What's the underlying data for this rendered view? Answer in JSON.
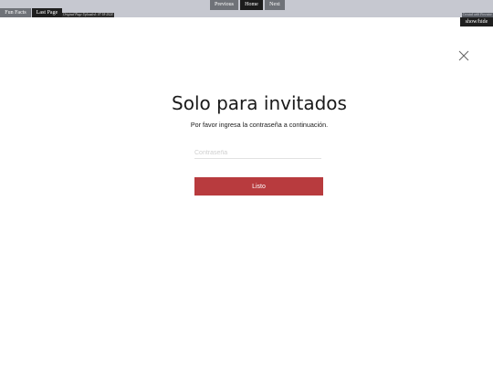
{
  "topbar": {
    "tabs": [
      {
        "label": "Fun Facts"
      },
      {
        "label": "Last Page"
      }
    ],
    "uploaded": "Original Page Uploaded: 07-18-2024",
    "nav": {
      "previous": "Previous",
      "home": "Home",
      "next": "Next"
    },
    "archived": "Created with Freewire",
    "showhide": "show/hide"
  },
  "dialog": {
    "title": "Solo para invitados",
    "subtitle": "Por favor ingresa la contraseña a continuación.",
    "password_placeholder": "Contraseña",
    "submit_label": "Listo"
  },
  "colors": {
    "topbar_bg": "#c6c8d0",
    "accent_button": "#b83b3e"
  }
}
